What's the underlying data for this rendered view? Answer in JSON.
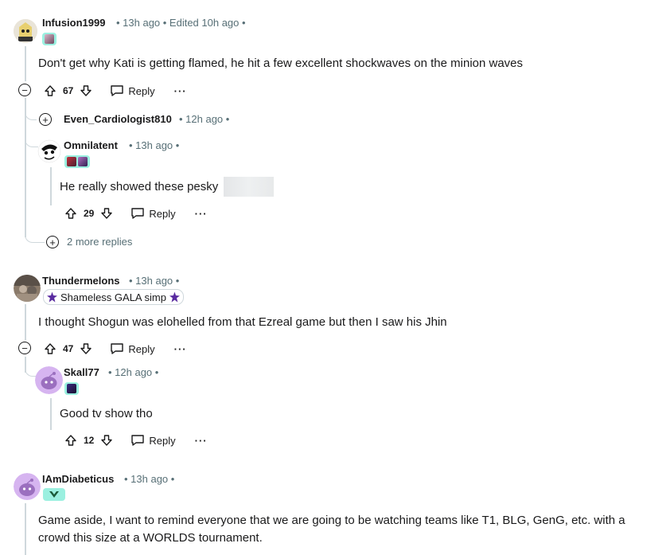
{
  "comments": {
    "c1": {
      "username": "Infusion1999",
      "meta": "• 13h ago • Edited 10h ago •",
      "body": "Don't get why Kati is getting flamed, he hit a few excellent shockwaves on the minion waves",
      "votes": "67",
      "reply_label": "Reply",
      "more_label": "···"
    },
    "c1_collapsed": {
      "username": "Even_Cardiologist810",
      "meta": "• 12h ago •",
      "expand_label": "+"
    },
    "c1_r2": {
      "username": "Omnilatent",
      "meta": "• 13h ago •",
      "body": "He really showed these pesky",
      "votes": "29",
      "reply_label": "Reply",
      "more_label": "···"
    },
    "c1_more": {
      "label": "2 more replies"
    },
    "c2": {
      "username": "Thundermelons",
      "meta": "• 13h ago •",
      "flair_text": "Shameless GALA simp",
      "body": "I thought Shogun was elohelled from that Ezreal game but then I saw his Jhin",
      "votes": "47",
      "reply_label": "Reply",
      "more_label": "···"
    },
    "c2_r1": {
      "username": "Skall77",
      "meta": "• 12h ago •",
      "body": "Good tv show tho",
      "votes": "12",
      "reply_label": "Reply",
      "more_label": "···"
    },
    "c3": {
      "username": "IAmDiabeticus",
      "meta": "• 13h ago •",
      "body_line1": "Game aside, I want to remind everyone that we are going to be watching teams like T1, BLG, GenG, etc. with a",
      "body_line2": "crowd this size at a WORLDS tournament."
    }
  },
  "colors": {
    "flair_bg": "#9bf0e0",
    "thread_line": "#cfd8dc",
    "meta_text": "#576f76",
    "snoo_purple": "#c9a8e8"
  }
}
